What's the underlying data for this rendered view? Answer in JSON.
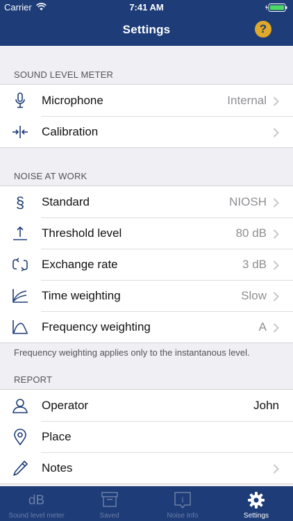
{
  "status_bar": {
    "carrier": "Carrier",
    "time": "7:41 AM"
  },
  "nav": {
    "title": "Settings",
    "help_label": "?"
  },
  "sections": {
    "sound_level_meter": {
      "header": "SOUND LEVEL METER",
      "rows": [
        {
          "label": "Microphone",
          "value": "Internal",
          "icon": "microphone-icon"
        },
        {
          "label": "Calibration",
          "value": "",
          "icon": "calibration-icon"
        }
      ]
    },
    "noise_at_work": {
      "header": "NOISE AT WORK",
      "rows": [
        {
          "label": "Standard",
          "value": "NIOSH",
          "icon": "section-sign-icon"
        },
        {
          "label": "Threshold level",
          "value": "80 dB",
          "icon": "threshold-arrow-icon"
        },
        {
          "label": "Exchange rate",
          "value": "3 dB",
          "icon": "exchange-icon"
        },
        {
          "label": "Time weighting",
          "value": "Slow",
          "icon": "time-weighting-curve-icon"
        },
        {
          "label": "Frequency weighting",
          "value": "A",
          "icon": "frequency-weighting-curve-icon"
        }
      ],
      "footnote": "Frequency weighting applies only to the instantanous level."
    },
    "report": {
      "header": "REPORT",
      "rows": [
        {
          "label": "Operator",
          "value": "John",
          "icon": "person-icon"
        },
        {
          "label": "Place",
          "value": "",
          "icon": "location-pin-icon"
        },
        {
          "label": "Notes",
          "value": "",
          "icon": "pen-icon"
        }
      ]
    }
  },
  "tabbar": {
    "tabs": [
      {
        "label": "Sound level meter",
        "icon_text": "dB",
        "icon": "db-icon",
        "active": false
      },
      {
        "label": "Saved",
        "icon": "saved-box-icon",
        "active": false
      },
      {
        "label": "Noise Info",
        "icon_text": "i",
        "icon": "info-icon",
        "active": false
      },
      {
        "label": "Settings",
        "icon": "gear-icon",
        "active": true
      }
    ]
  },
  "colors": {
    "navbar": "#1d3c78",
    "help_badge": "#e0a92a",
    "icon_blue": "#1d3c78",
    "secondary_text": "#8e8e93",
    "tab_inactive": "#6d7fa6"
  }
}
